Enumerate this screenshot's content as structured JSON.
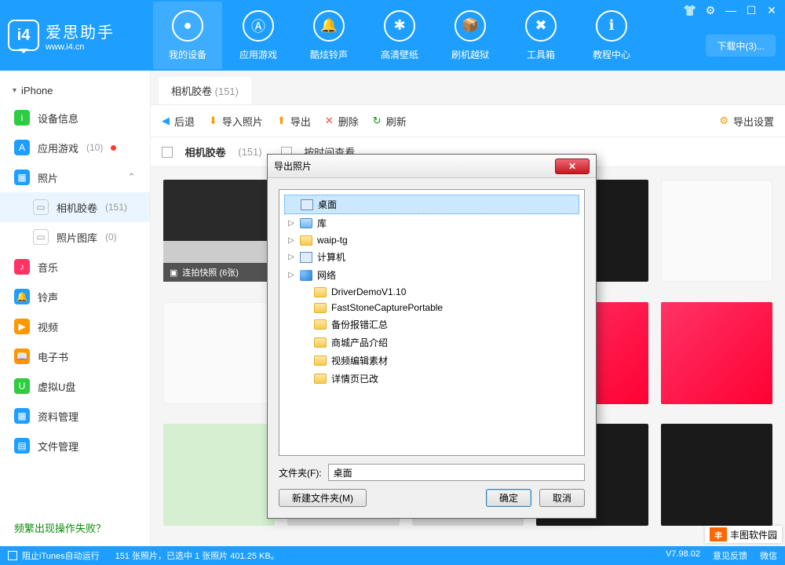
{
  "logo": {
    "badge": "i4",
    "title": "爱思助手",
    "url": "www.i4.cn"
  },
  "nav": [
    {
      "label": "我的设备",
      "active": true,
      "icon": "apple"
    },
    {
      "label": "应用游戏",
      "active": false,
      "icon": "appstore"
    },
    {
      "label": "酷炫铃声",
      "active": false,
      "icon": "bell"
    },
    {
      "label": "高清壁纸",
      "active": false,
      "icon": "flower"
    },
    {
      "label": "刷机越狱",
      "active": false,
      "icon": "box"
    },
    {
      "label": "工具箱",
      "active": false,
      "icon": "wrench"
    },
    {
      "label": "教程中心",
      "active": false,
      "icon": "info"
    }
  ],
  "download_btn": "下载中(3)...",
  "sidebar": {
    "root": "iPhone",
    "items": [
      {
        "icon_color": "#2ECC40",
        "icon": "i",
        "label": "设备信息"
      },
      {
        "icon_color": "#1E9FFF",
        "icon": "A",
        "label": "应用游戏",
        "count": "(10)",
        "dot": true
      },
      {
        "icon_color": "#1E9FFF",
        "icon": "▦",
        "label": "照片",
        "expandable": true
      },
      {
        "sub": true,
        "active": true,
        "icon": "gray",
        "label": "相机胶卷",
        "count": "(151)"
      },
      {
        "sub": true,
        "icon": "gray",
        "label": "照片图库",
        "count": "(0)"
      },
      {
        "icon_color": "#FF3366",
        "icon": "♪",
        "label": "音乐"
      },
      {
        "icon_color": "#1E9FFF",
        "icon": "🔔",
        "label": "铃声"
      },
      {
        "icon_color": "#FF9800",
        "icon": "▶",
        "label": "视频"
      },
      {
        "icon_color": "#FF9800",
        "icon": "📖",
        "label": "电子书"
      },
      {
        "icon_color": "#2ECC40",
        "icon": "U",
        "label": "虚拟U盘"
      },
      {
        "icon_color": "#1E9FFF",
        "icon": "▦",
        "label": "资料管理"
      },
      {
        "icon_color": "#1E9FFF",
        "icon": "▤",
        "label": "文件管理"
      }
    ],
    "help": "频繁出现操作失败？"
  },
  "tab": {
    "label": "相机胶卷",
    "count": "(151)"
  },
  "toolbar": {
    "back": "后退",
    "import": "导入照片",
    "export": "导出",
    "delete": "删除",
    "refresh": "刷新",
    "settings": "导出设置"
  },
  "subbar": {
    "camera_roll": "相机胶卷",
    "camera_count": "(151)",
    "by_time": "按时间查看"
  },
  "photo_label": "连拍快照 (6张)",
  "modal": {
    "title": "导出照片",
    "tree": [
      {
        "label": "桌面",
        "selected": true,
        "icon": "desktop",
        "indent": 0,
        "expand": ""
      },
      {
        "label": "库",
        "icon": "library",
        "indent": 0,
        "expand": "▷"
      },
      {
        "label": "waip-tg",
        "icon": "user",
        "indent": 0,
        "expand": "▷"
      },
      {
        "label": "计算机",
        "icon": "computer",
        "indent": 0,
        "expand": "▷"
      },
      {
        "label": "网络",
        "icon": "network",
        "indent": 0,
        "expand": "▷"
      },
      {
        "label": "DriverDemoV1.10",
        "icon": "folder",
        "indent": 1,
        "expand": ""
      },
      {
        "label": "FastStoneCapturePortable",
        "icon": "folder",
        "indent": 1,
        "expand": ""
      },
      {
        "label": "备份报错汇总",
        "icon": "folder",
        "indent": 1,
        "expand": ""
      },
      {
        "label": "商城产品介绍",
        "icon": "folder",
        "indent": 1,
        "expand": ""
      },
      {
        "label": "视频编辑素材",
        "icon": "folder",
        "indent": 1,
        "expand": ""
      },
      {
        "label": "详情页已改",
        "icon": "folder",
        "indent": 1,
        "expand": ""
      }
    ],
    "folder_label": "文件夹(F):",
    "folder_value": "桌面",
    "new_folder": "新建文件夹(M)",
    "ok": "确定",
    "cancel": "取消"
  },
  "statusbar": {
    "itunes": "阻止iTunes自动运行",
    "info": "151 张照片，已选中 1 张照片 401.25 KB。",
    "version": "V7.98.02",
    "feedback": "意见反馈",
    "wechat": "微信"
  },
  "watermark": "丰图软件园"
}
